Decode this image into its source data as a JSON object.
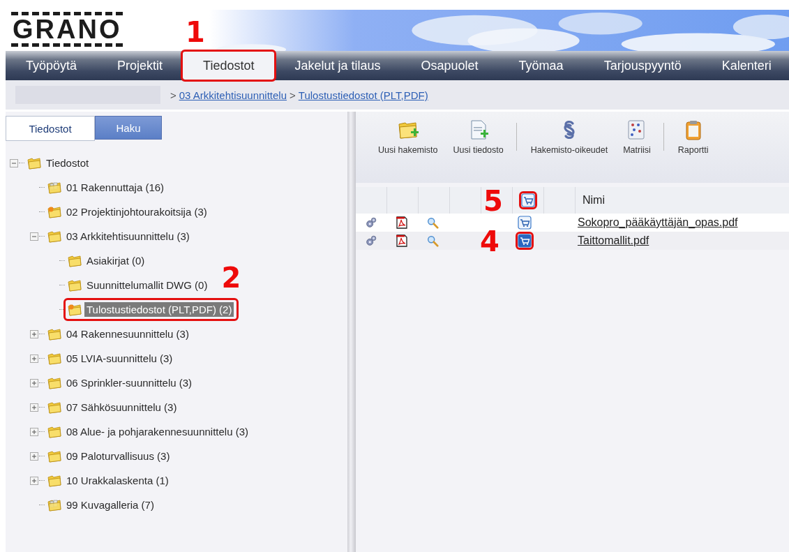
{
  "logo": "GRANO",
  "nav": [
    {
      "label": "Työpöytä",
      "selected": false
    },
    {
      "label": "Projektit",
      "selected": false
    },
    {
      "label": "Tiedostot",
      "selected": true,
      "callout": "1"
    },
    {
      "label": "Jakelut ja tilaus",
      "selected": false
    },
    {
      "label": "Osapuolet",
      "selected": false
    },
    {
      "label": "Työmaa",
      "selected": false
    },
    {
      "label": "Tarjouspyyntö",
      "selected": false
    },
    {
      "label": "Kalenteri",
      "selected": false
    }
  ],
  "breadcrumb": [
    {
      "separator": ">",
      "link": "03 Arkkitehtisuunnittelu"
    },
    {
      "separator": ">",
      "link": "Tulostustiedostot (PLT,PDF)"
    }
  ],
  "side_tabs": [
    {
      "label": "Tiedostot",
      "selected": true
    },
    {
      "label": "Haku",
      "selected": false
    }
  ],
  "tree": [
    {
      "label": "Tiedostot",
      "kind": "folder",
      "expanded": true,
      "selected": false,
      "children": [
        {
          "label": "01 Rakennuttaja (16)",
          "kind": "shared",
          "selected": false
        },
        {
          "label": "02 Projektinjohtourakoitsija (3)",
          "kind": "marked",
          "selected": false
        },
        {
          "label": "03 Arkkitehtisuunnittelu (3)",
          "kind": "folder",
          "expanded": true,
          "selected": false,
          "children": [
            {
              "label": "Asiakirjat (0)",
              "kind": "folder",
              "selected": false
            },
            {
              "label": "Suunnittelumallit DWG (0)",
              "kind": "folder",
              "selected": false
            },
            {
              "label": "Tulostustiedostot (PLT,PDF) (2)",
              "kind": "marked",
              "selected": true,
              "callout": "2"
            }
          ]
        },
        {
          "label": "04 Rakennesuunnittelu (3)",
          "kind": "folder",
          "expanded": false,
          "selected": false
        },
        {
          "label": "05 LVIA-suunnittelu (3)",
          "kind": "folder",
          "expanded": false,
          "selected": false
        },
        {
          "label": "06 Sprinkler-suunnittelu (3)",
          "kind": "folder",
          "expanded": false,
          "selected": false
        },
        {
          "label": "07 Sähkösuunnittelu (3)",
          "kind": "folder",
          "expanded": false,
          "selected": false
        },
        {
          "label": "08 Alue- ja pohjarakennesuunnittelu (3)",
          "kind": "folder",
          "expanded": false,
          "selected": false
        },
        {
          "label": "09 Paloturvallisuus (3)",
          "kind": "folder",
          "expanded": false,
          "selected": false
        },
        {
          "label": "10 Urakkalaskenta (1)",
          "kind": "folder",
          "expanded": false,
          "selected": false
        },
        {
          "label": "99 Kuvagalleria (7)",
          "kind": "shared",
          "selected": false
        }
      ]
    }
  ],
  "toolbar": [
    {
      "label": "Uusi hakemisto",
      "kind": "new-folder"
    },
    {
      "label": "Uusi tiedosto",
      "kind": "new-file",
      "separator_after": true
    },
    {
      "label": "Hakemisto-oikeudet",
      "kind": "rights"
    },
    {
      "label": "Matriisi",
      "kind": "matrix",
      "separator_after": true
    },
    {
      "label": "Raportti",
      "kind": "report"
    }
  ],
  "table": {
    "name_column": "Nimi",
    "cart_callout": "5",
    "rows": [
      {
        "name": "Sokopro_pääkäyttäjän_opas.pdf",
        "ordered": false
      },
      {
        "name": "Taittomallit.pdf",
        "ordered": true,
        "callout": "4"
      }
    ]
  }
}
